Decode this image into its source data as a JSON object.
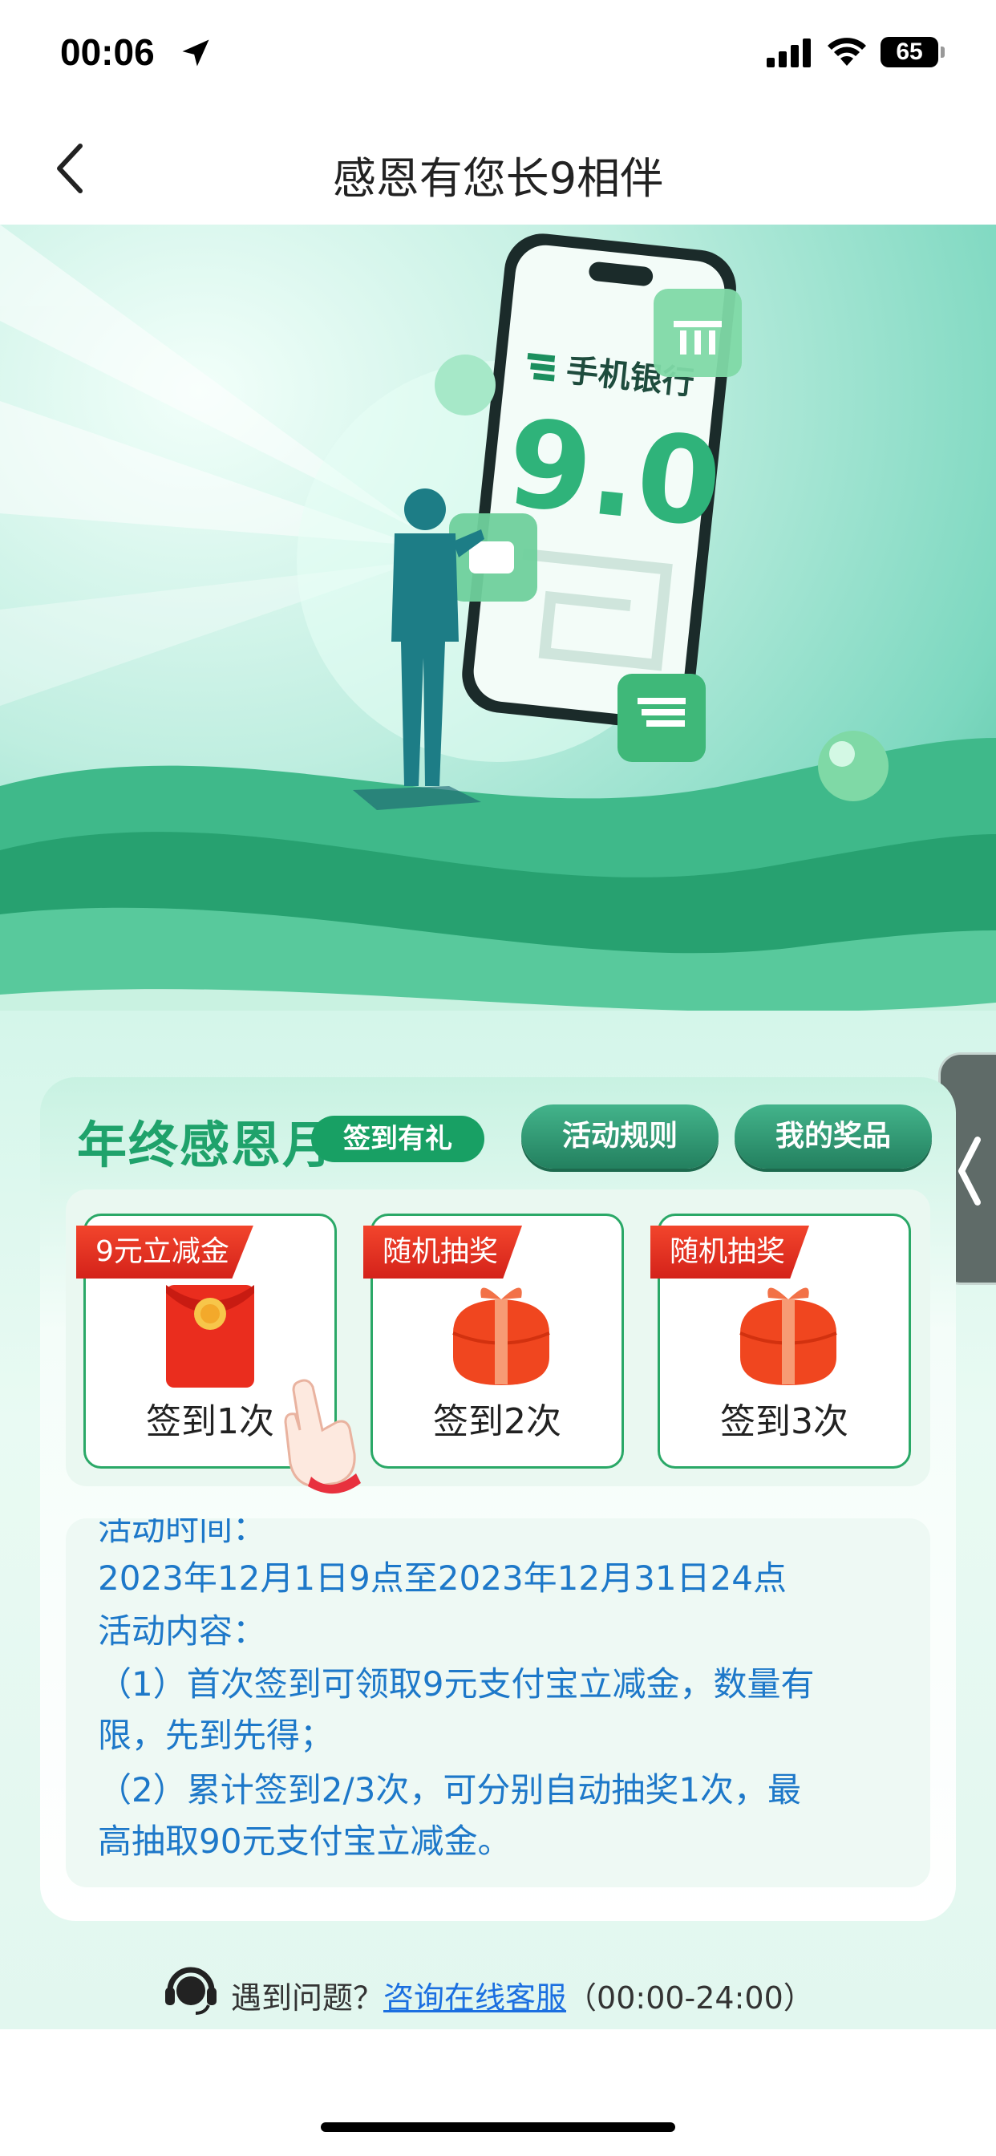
{
  "status_bar": {
    "time": "00:06",
    "battery": "65"
  },
  "nav": {
    "title": "感恩有您长9相伴"
  },
  "banner": {
    "phone_brand": "手机银行",
    "version": "9.0"
  },
  "card": {
    "title": "年终感恩月",
    "subtitle": "签到有礼",
    "rules_button": "活动规则",
    "prizes_button": "我的奖品",
    "steps": [
      {
        "ribbon": "9元立减金",
        "label": "签到1次",
        "icon": "red-envelope-icon"
      },
      {
        "ribbon": "随机抽奖",
        "label": "签到2次",
        "icon": "gift-box-icon"
      },
      {
        "ribbon": "随机抽奖",
        "label": "签到3次",
        "icon": "gift-box-icon"
      }
    ],
    "info": {
      "time_label": "活动时间：",
      "time_value": "2023年12月1日9点至2023年12月31日24点",
      "content_label": "活动内容：",
      "item1_line1": "（1）首次签到可领取9元支付宝立减金，数量有",
      "item1_line2": "限，先到先得；",
      "item2_line1": "（2）累计签到2/3次，可分别自动抽奖1次，最",
      "item2_line2": "高抽取90元支付宝立减金。"
    }
  },
  "help": {
    "question": "遇到问题？",
    "link": "咨询在线客服",
    "hours": "（00:00-24:00）"
  }
}
